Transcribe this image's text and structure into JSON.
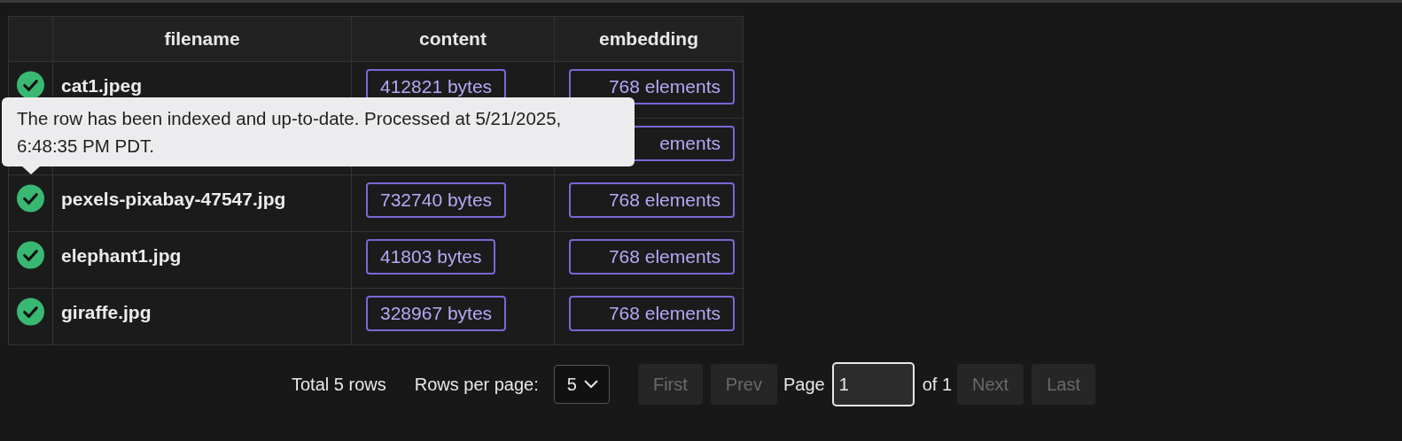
{
  "table": {
    "columns": [
      "filename",
      "content",
      "embedding"
    ],
    "rows": [
      {
        "indexed": true,
        "filename": "cat1.jpeg",
        "content": "412821 bytes",
        "embedding": "768 elements"
      },
      {
        "embedding": "ements"
      },
      {
        "indexed": true,
        "filename": "pexels-pixabay-47547.jpg",
        "content": "732740 bytes",
        "embedding": "768 elements",
        "tooltip": "The row has been indexed and up-to-date. Processed at 5/21/2025, 6:48:35 PM PDT."
      },
      {
        "indexed": true,
        "filename": "elephant1.jpg",
        "content": "41803 bytes",
        "embedding": "768 elements"
      },
      {
        "indexed": true,
        "filename": "giraffe.jpg",
        "content": "328967 bytes",
        "embedding": "768 elements"
      }
    ]
  },
  "pagination": {
    "total": "Total 5 rows",
    "rows_per_page_label": "Rows per page:",
    "rows_per_page": "5",
    "buttons_before": [
      {
        "label": "First",
        "disabled": true
      },
      {
        "label": "Prev",
        "disabled": true
      }
    ],
    "page_label": "Page",
    "page_value": "1",
    "page_of": "of 1",
    "buttons_after": [
      {
        "label": "Next",
        "disabled": true
      },
      {
        "label": "Last",
        "disabled": true
      }
    ]
  }
}
